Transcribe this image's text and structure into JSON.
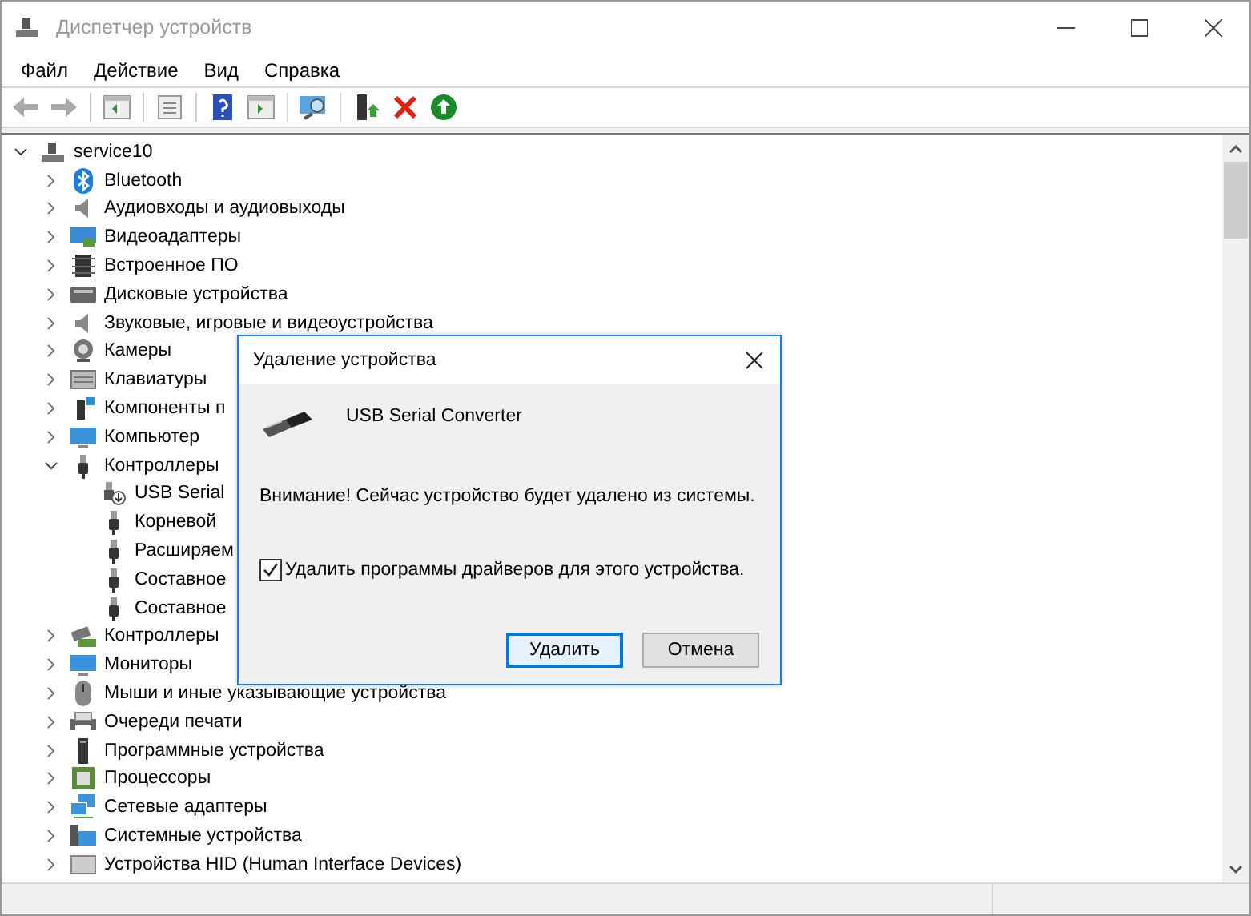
{
  "window": {
    "title": "Диспетчер устройств"
  },
  "menu": [
    "Файл",
    "Действие",
    "Вид",
    "Справка"
  ],
  "tree": {
    "label": "service10",
    "expanded": true,
    "children": [
      {
        "label": "Bluetooth",
        "expanded": false
      },
      {
        "label": "Аудиовходы и аудиовыходы",
        "expanded": false
      },
      {
        "label": "Видеоадаптеры",
        "expanded": false
      },
      {
        "label": "Встроенное ПО",
        "expanded": false
      },
      {
        "label": "Дисковые устройства",
        "expanded": false
      },
      {
        "label": "Звуковые, игровые и видеоустройства",
        "expanded": false
      },
      {
        "label": "Камеры",
        "expanded": false
      },
      {
        "label": "Клавиатуры",
        "expanded": false
      },
      {
        "label": "Компоненты п",
        "expanded": false
      },
      {
        "label": "Компьютер",
        "expanded": false
      },
      {
        "label": "Контроллеры",
        "expanded": true,
        "children": [
          {
            "label": "USB Serial"
          },
          {
            "label": "Корневой"
          },
          {
            "label": "Расширяем"
          },
          {
            "label": "Составное"
          },
          {
            "label": "Составное"
          }
        ]
      },
      {
        "label": "Контроллеры",
        "expanded": false
      },
      {
        "label": "Мониторы",
        "expanded": false
      },
      {
        "label": "Мыши и иные указывающие устройства",
        "expanded": false
      },
      {
        "label": "Очереди печати",
        "expanded": false
      },
      {
        "label": "Программные устройства",
        "expanded": false
      },
      {
        "label": "Процессоры",
        "expanded": false
      },
      {
        "label": "Сетевые адаптеры",
        "expanded": false
      },
      {
        "label": "Системные устройства",
        "expanded": false
      },
      {
        "label": "Устройства HID (Human Interface Devices)",
        "expanded": false
      }
    ]
  },
  "dialog": {
    "title": "Удаление устройства",
    "device": "USB Serial Converter",
    "warning": "Внимание! Сейчас устройство будет удалено из системы.",
    "checkbox": {
      "label": "Удалить программы драйверов для этого устройства.",
      "checked": true
    },
    "buttons": [
      {
        "label": "Удалить",
        "default": true
      },
      {
        "label": "Отмена",
        "default": false
      }
    ]
  }
}
